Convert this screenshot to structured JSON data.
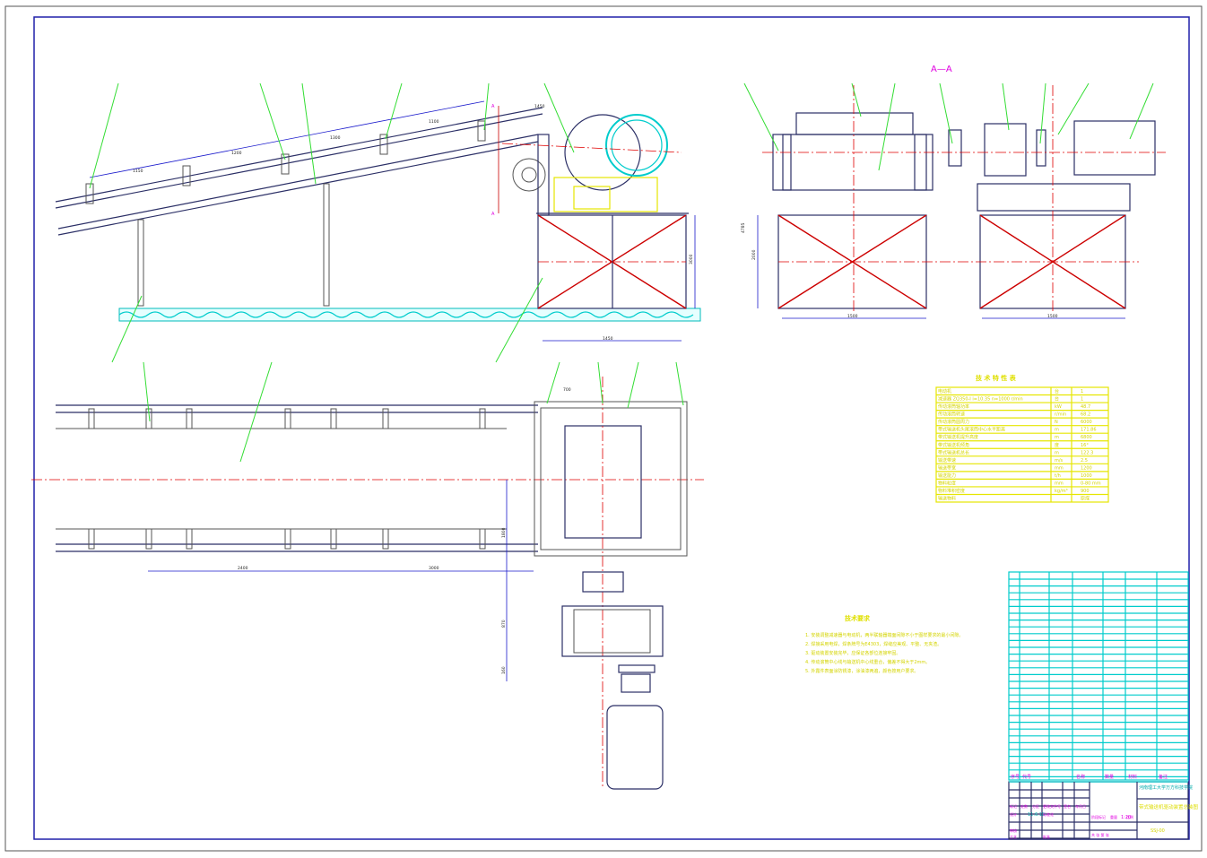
{
  "section_label": "A—A",
  "section_mark": "A",
  "dimensions": {
    "idler_spacing": [
      "1150",
      "1200",
      "1300",
      "1100",
      "1450"
    ],
    "front_height": "3000",
    "front_base": "1450",
    "side_height": "2000",
    "side_total": "4785",
    "side_base_1": "1500",
    "side_base_2": "1500",
    "plan_spacing": [
      "2400",
      "3000"
    ],
    "plan_width": "700",
    "plan_offset": "1800",
    "plan_drive_1": "870",
    "plan_drive_2": "160"
  },
  "tech_table": {
    "title": "技 术 特 性 表",
    "rows": [
      {
        "name": "电动机",
        "unit": "台",
        "value": "1"
      },
      {
        "name": "减速器 ZQ350-I   i=10.35   n=1000 r/min",
        "unit": "台",
        "value": "1"
      },
      {
        "name": "传动滚筒轴功率",
        "unit": "kW",
        "value": "48.7"
      },
      {
        "name": "传动滚筒转速",
        "unit": "r/min",
        "value": "68.2"
      },
      {
        "name": "传动滚筒圆周力",
        "unit": "N",
        "value": "6000"
      },
      {
        "name": "带式输送机头尾滚筒中心水平距离",
        "unit": "m",
        "value": "171.86"
      },
      {
        "name": "带式输送机提升高度",
        "unit": "m",
        "value": "6800"
      },
      {
        "name": "带式输送机倾角",
        "unit": "度",
        "value": "16°"
      },
      {
        "name": "带式输送机总长",
        "unit": "m",
        "value": "122.3"
      },
      {
        "name": "输送带速",
        "unit": "m/s",
        "value": "2.5"
      },
      {
        "name": "输送带宽",
        "unit": "mm",
        "value": "1200"
      },
      {
        "name": "输送能力",
        "unit": "t/h",
        "value": "1000"
      },
      {
        "name": "物料粒度",
        "unit": "mm",
        "value": "0-80 mm"
      },
      {
        "name": "物料堆积密度",
        "unit": "kg/m³",
        "value": "900"
      },
      {
        "name": "输送物料",
        "unit": "",
        "value": "原煤"
      }
    ]
  },
  "tech_requirements": {
    "title": "技术要求",
    "items": [
      "1. 安装调整减速器与电动机，两半联轴器端面间隙不小于图样要求的最小间隙。",
      "2. 焊接采用电焊，焊条牌号为E4303，焊缝应美观、平整、无夹渣。",
      "3. 驱动装置安装完毕，应保证各部位连接牢固。",
      "4. 传动滚筒中心线与输送机中心线重合，偏差不得大于2mm。",
      "5. 外露件表面涂防锈漆，涂油漆两遍，颜色按用户要求。"
    ]
  },
  "title_block": {
    "school": "河南理工大学万方科技学院",
    "drawing_title": "带式输送机驱动装置总装图",
    "drawing_no": "SSJ-00",
    "labels": [
      "标记",
      "处数",
      "分区",
      "更改文件号",
      "签名",
      "年月日",
      "设计",
      "标准化",
      "阶段标记",
      "重量",
      "比例",
      "审核",
      "工艺",
      "批准",
      "共 张 第 张"
    ],
    "designer_date": "11.6.10",
    "scale": "1:20"
  },
  "bom_header": [
    "序号",
    "代号",
    "名称",
    "数量",
    "材料",
    "备注"
  ]
}
